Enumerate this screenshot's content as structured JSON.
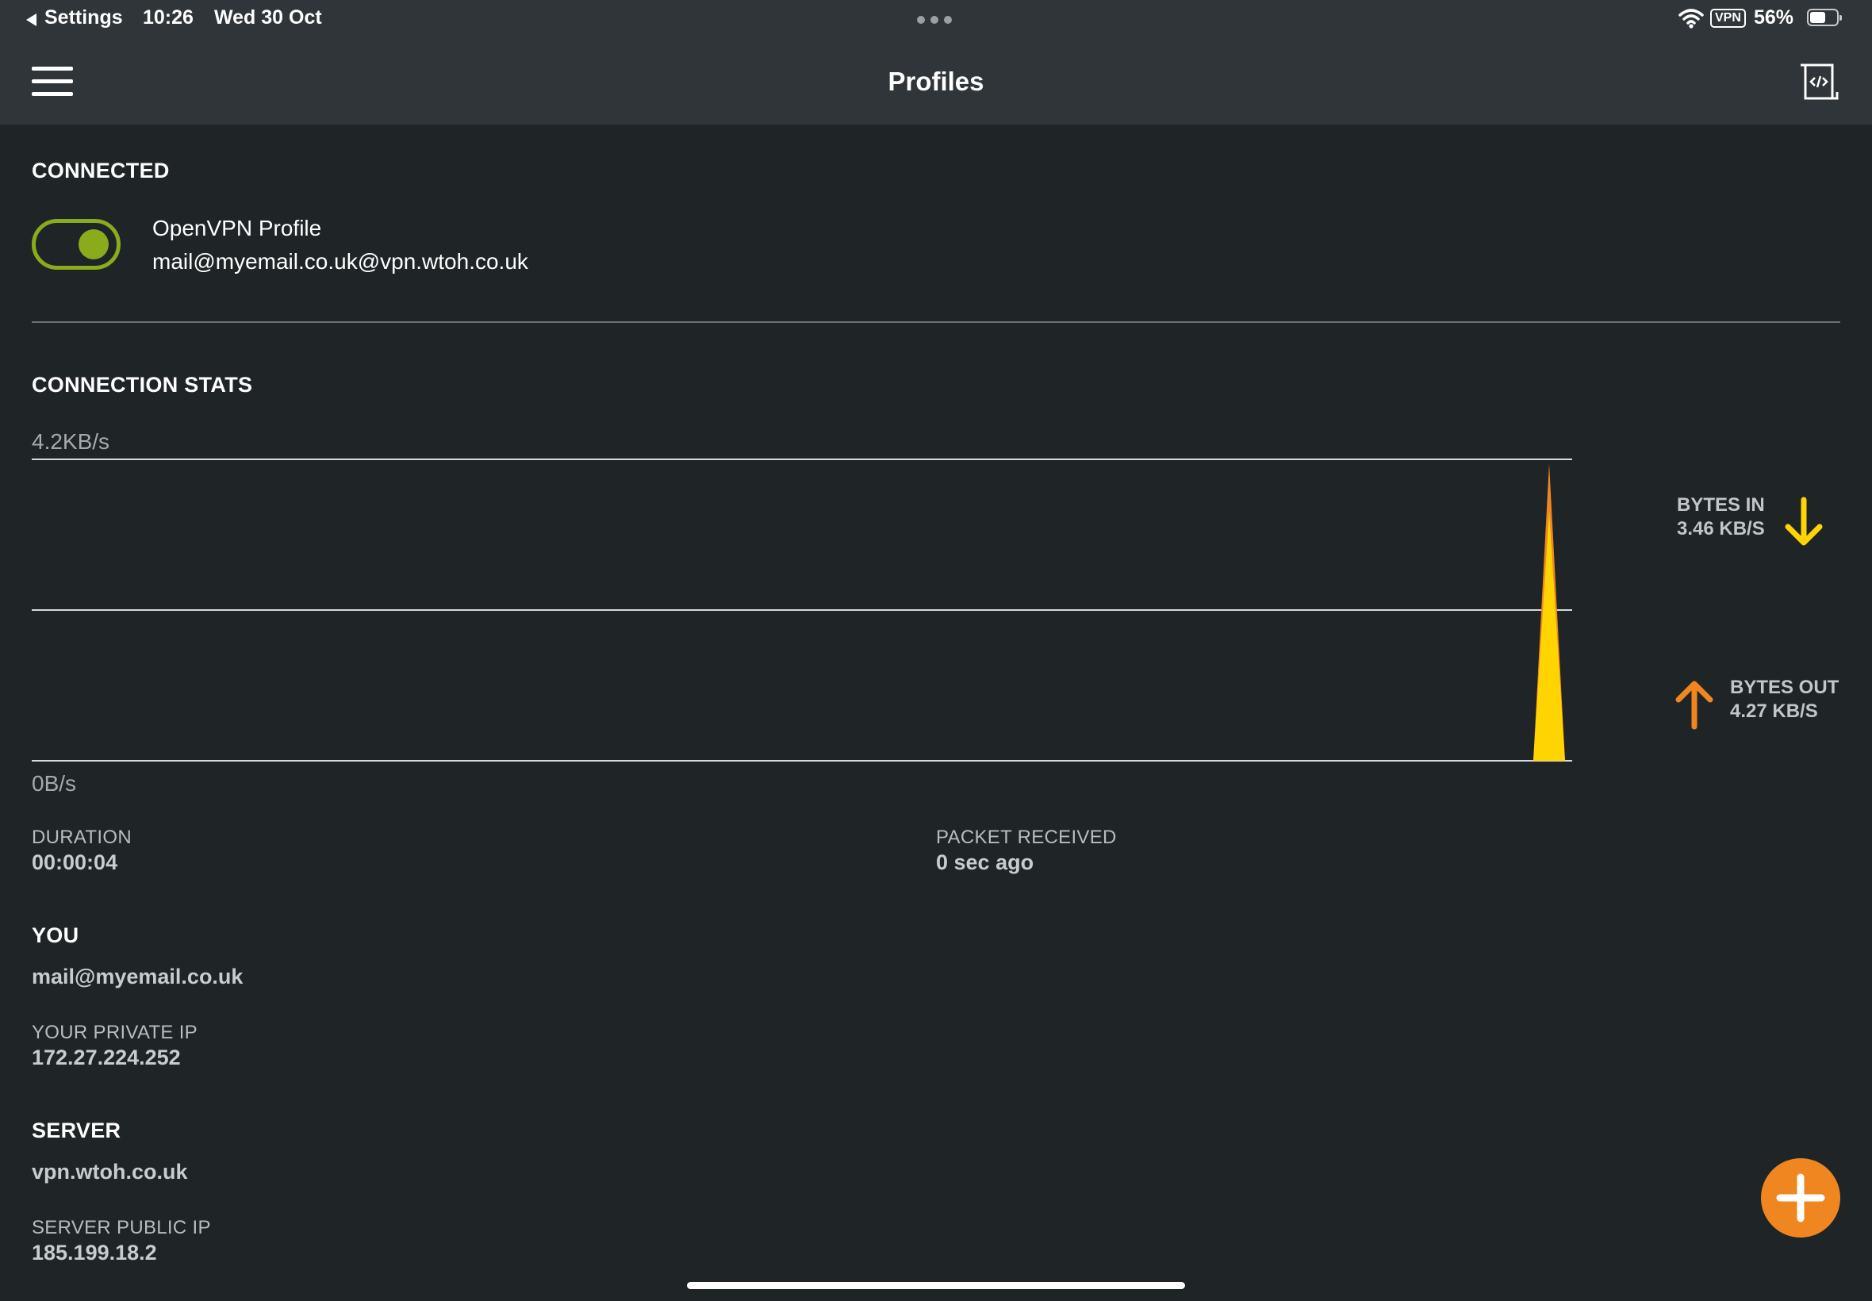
{
  "status_bar": {
    "back_label": "Settings",
    "time": "10:26",
    "date": "Wed 30 Oct",
    "vpn_badge": "VPN",
    "battery": "56%"
  },
  "nav": {
    "title": "Profiles",
    "menu_icon": "hamburger-menu-icon",
    "log_icon": "code-document-icon"
  },
  "connected": {
    "heading": "CONNECTED",
    "toggle_on": true,
    "profile_name": "OpenVPN Profile",
    "profile_address": "mail@myemail.co.uk@vpn.wtoh.co.uk",
    "toggle_color": "#8aab1c"
  },
  "stats": {
    "heading": "CONNECTION STATS",
    "max_label": "4.2KB/s",
    "min_label": "0B/s",
    "bytes_in_label": "BYTES IN",
    "bytes_in_value": "3.46 KB/S",
    "bytes_out_label": "BYTES OUT",
    "bytes_out_value": "4.27 KB/S",
    "in_color": "#ffd400",
    "out_color": "#f0861f",
    "duration_label": "DURATION",
    "duration_value": "00:00:04",
    "packet_label": "PACKET RECEIVED",
    "packet_value": "0 sec ago"
  },
  "you": {
    "heading": "YOU",
    "email": "mail@myemail.co.uk",
    "private_ip_label": "YOUR PRIVATE IP",
    "private_ip": "172.27.224.252"
  },
  "server": {
    "heading": "SERVER",
    "host": "vpn.wtoh.co.uk",
    "public_ip_label": "SERVER PUBLIC IP",
    "public_ip": "185.199.18.2"
  },
  "fab": {
    "icon": "plus-icon",
    "color": "#f0861f"
  },
  "chart_data": {
    "type": "area",
    "ylim": [
      0,
      4.2
    ],
    "yunit": "KB/s",
    "series": [
      {
        "name": "BYTES OUT",
        "color": "#f0861f",
        "peak": 4.13
      },
      {
        "name": "BYTES IN",
        "color": "#ffd400",
        "peak": 3.46
      }
    ]
  }
}
